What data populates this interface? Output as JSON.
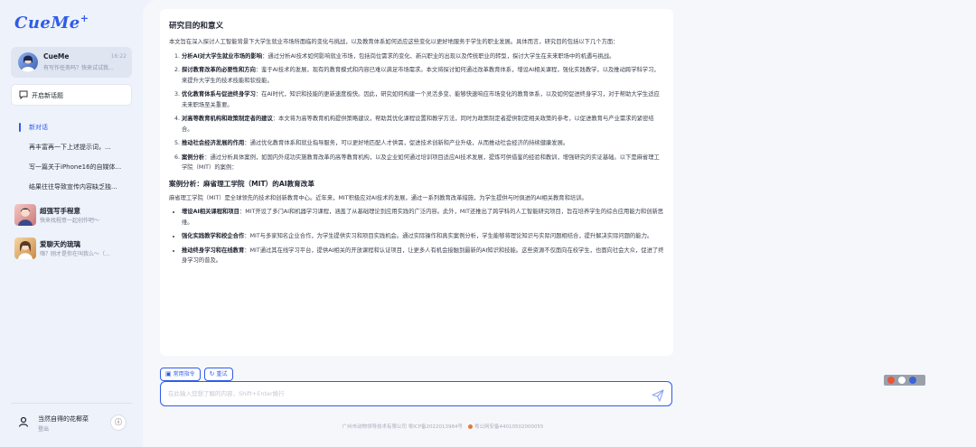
{
  "app": {
    "logo": "CueMe",
    "logo_mark": "+"
  },
  "sidebar": {
    "current_chat": {
      "title": "CueMe",
      "subtitle": "有写作任务吗？快来试试我...",
      "time": "16:22"
    },
    "new_topic_label": "开启新话题",
    "history": [
      {
        "label": "新对话",
        "active": true
      },
      {
        "label": "再丰富再一下上述提示词，...",
        "active": false
      },
      {
        "label": "写一篇关于iPhone16的自媒体...",
        "active": false
      },
      {
        "label": "结果往往导致宣传内容缺乏独...",
        "active": false
      }
    ],
    "bots": [
      {
        "title": "超强写手程意",
        "subtitle": "快来找程意一起创作吧～"
      },
      {
        "title": "爱聊天的琉璃",
        "subtitle": "嗨？刚才是你在叫我么～（..."
      }
    ],
    "user": {
      "name": "当然自得的花椰菜",
      "logout": "登出"
    }
  },
  "document": {
    "heading": "研究目的和意义",
    "intro": "本文旨在深入探讨人工智能背景下大学生就业市场所面临的变化与挑战，以及教育体系如何适应这些变化以更好地服务于学生的职业发展。具体而言，研究目的包括以下几个方面：",
    "goals": [
      {
        "title": "分析AI对大学生就业市场的影响",
        "text": "：通过分析AI技术如何影响就业市场，包括岗位需求的变化、新兴职业的出现以及传统职业的转型，探讨大学生在未来职场中的机遇与挑战。"
      },
      {
        "title": "探讨教育改革的必要性和方向",
        "text": "：鉴于AI技术的发展，现有的教育模式和内容已难以满足市场需求。本文将探讨如何通过改革教育体系，增设AI相关课程，强化实践教学，以及推动跨学科学习，来提升大学生的技术技能和软技能。"
      },
      {
        "title": "优化教育体系与促进终身学习",
        "text": "：在AI时代，知识和技能的更新速度极快。因此，研究如何构建一个灵活多变、能够快速响应市场变化的教育体系，以及如何促进终身学习，对于帮助大学生适应未来职场至关重要。"
      },
      {
        "title": "对高等教育机构和政策制定者的建议",
        "text": "：本文将为高等教育机构提供策略建议，帮助其优化课程设置和教学方法，同时为政策制定者提供制定相关政策的参考，以促进教育与产业需求的紧密结合。"
      },
      {
        "title": "推动社会经济发展的作用",
        "text": "：通过优化教育体系和就业指导服务，可以更好地匹配人才供需，促进技术创新和产业升级，从而推动社会经济的持续健康发展。"
      },
      {
        "title": "案例分析",
        "text": "：通过分析具体案例，如国内外成功实施教育改革的高等教育机构，以及企业如何通过培训项目适应AI技术发展，提炼可供借鉴的经验和教训，增强研究的实证基础。以下是麻省理工学院（MIT）的案例："
      }
    ],
    "case_heading": "案例分析：麻省理工学院（MIT）的AI教育改革",
    "case_intro": "麻省理工学院（MIT）是全球领先的技术和创新教育中心。近年来，MIT积极应对AI技术的发展，通过一系列教育改革措施，为学生提供与时俱进的AI相关教育和培训。",
    "case_points": [
      {
        "title": "增设AI相关课程和项目",
        "text": "：MIT开设了多门AI和机器学习课程，涵盖了从基础理论到应用实践的广泛内容。此外，MIT还推出了跨学科的人工智能研究项目，旨在培养学生的综合应用能力和创新思维。"
      },
      {
        "title": "强化实践教学和校企合作",
        "text": "：MIT与多家知名企业合作，为学生提供实习和项目实践机会。通过实际操作和真实案例分析，学生能够将理论知识与实际问题相结合，提升解决实际问题的能力。"
      },
      {
        "title": "推动终身学习和在线教育",
        "text": "：MIT通过其在线学习平台，提供AI相关的开放课程和认证项目，让更多人有机会接触到最新的AI知识和技能。这些资源不仅面向在校学生，也面向社会大众，促进了终身学习的普及。"
      }
    ]
  },
  "actions": {
    "commands_label": "常用指令",
    "retry_label": "重试"
  },
  "input": {
    "placeholder": "在此输入您想了解的内容，Shift+Enter换行"
  },
  "footer": {
    "icp": "广州市动物领导技术有限公司 粤ICP备2022013984号",
    "police": "粤公网安备44010502000055"
  },
  "colors": {
    "accent": "#2f5bea",
    "sidebar_bg": "#eef2fa",
    "main_bg": "#f6f7fb"
  }
}
